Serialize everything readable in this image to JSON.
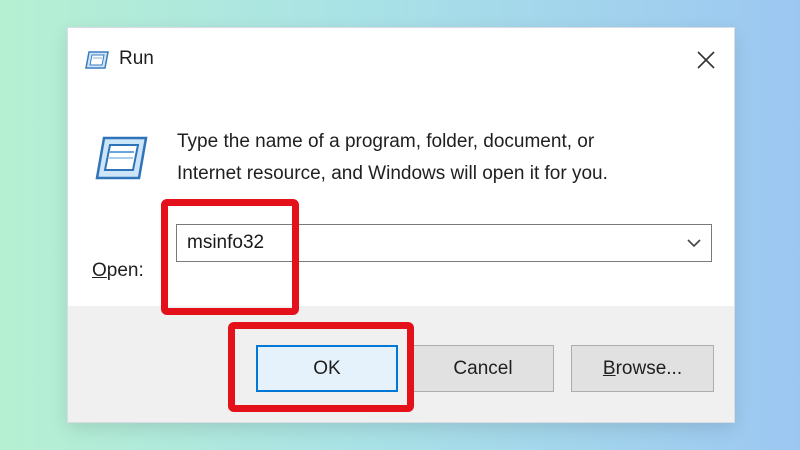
{
  "window": {
    "title": "Run"
  },
  "icons": {
    "title": "run-icon",
    "big": "run-icon",
    "close": "close-icon",
    "dropdown": "chevron-down-icon"
  },
  "description": {
    "line1": "Type the name of a program, folder, document, or",
    "line2": "Internet resource, and Windows will open it for you."
  },
  "open": {
    "label_mnemonic": "O",
    "label_rest": "pen:",
    "value": "msinfo32"
  },
  "buttons": {
    "ok": "OK",
    "cancel": "Cancel",
    "browse_mnemonic": "B",
    "browse_rest": "rowse..."
  },
  "colors": {
    "highlight": "#e4111b",
    "focus": "#0078d7"
  }
}
